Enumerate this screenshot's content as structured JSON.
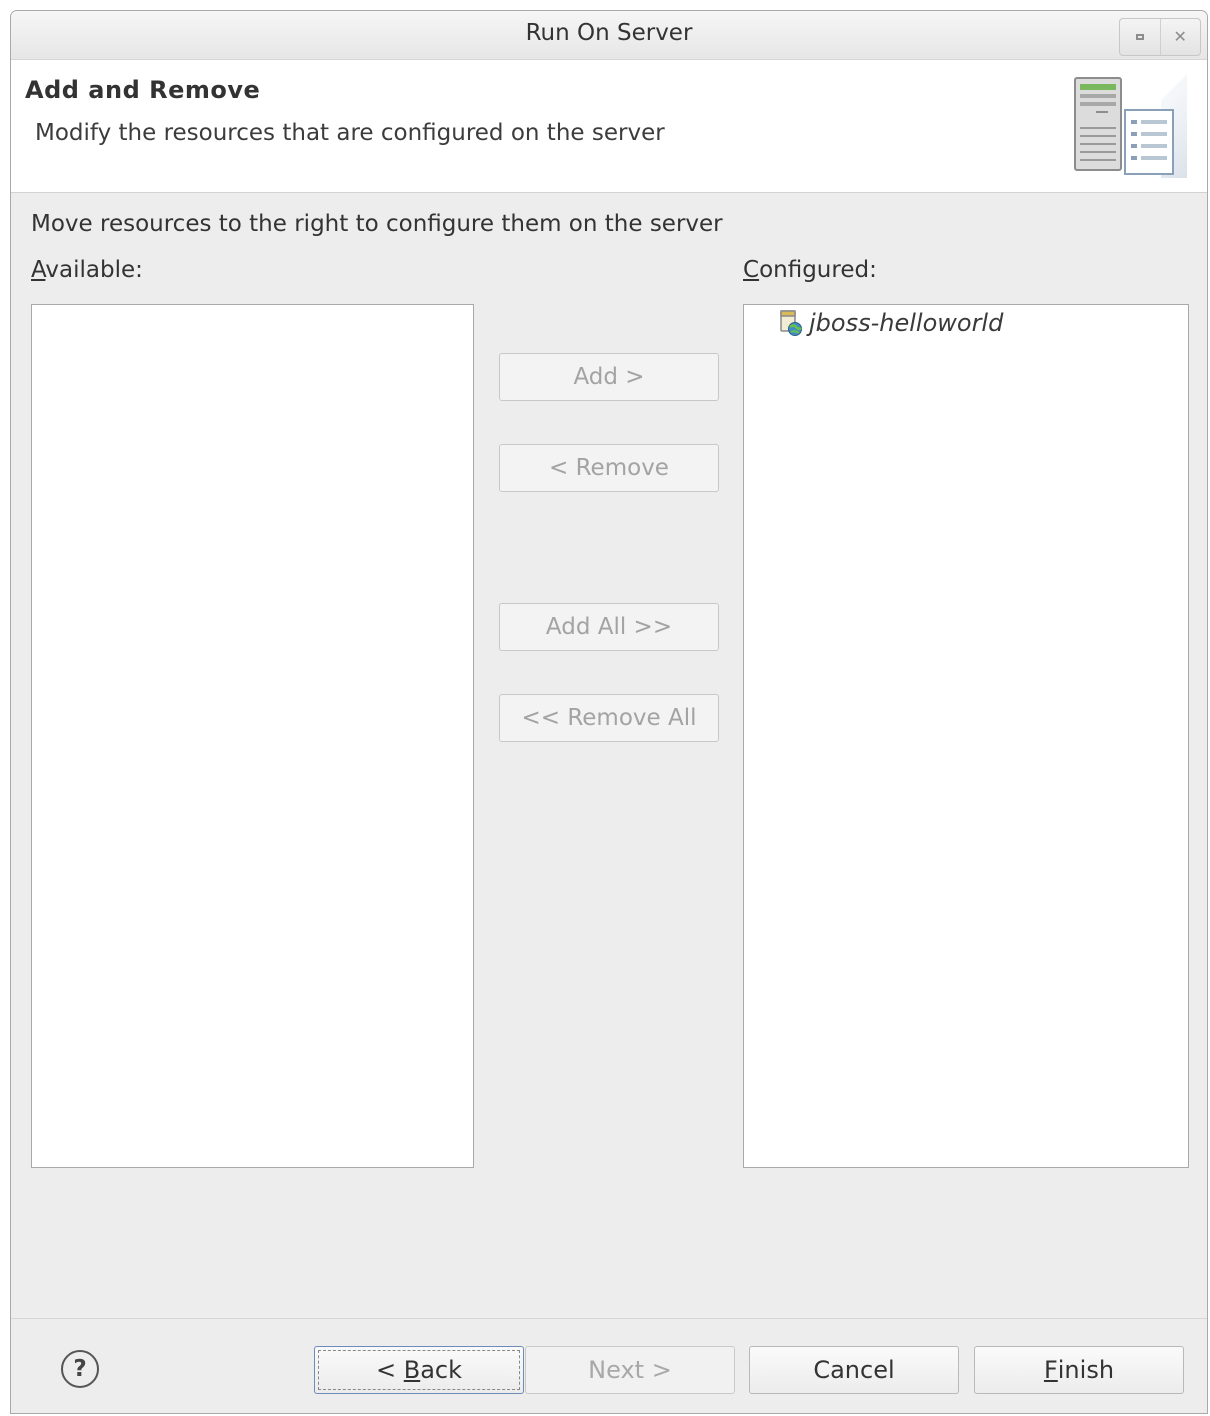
{
  "window": {
    "title": "Run On Server"
  },
  "banner": {
    "title": "Add and Remove",
    "subtitle": "Modify the resources that are configured on the server",
    "icon": "server-wizard-icon"
  },
  "content": {
    "instruction": "Move resources to the right to configure them on the server",
    "available": {
      "label_mnemonic": "A",
      "label_rest": "vailable:",
      "items": []
    },
    "configured": {
      "label_mnemonic": "C",
      "label_rest": "onfigured:",
      "items": [
        {
          "label": "jboss-helloworld",
          "icon": "web-project-icon"
        }
      ]
    },
    "buttons": {
      "add": "Add >",
      "remove": "< Remove",
      "add_all": "Add All >>",
      "remove_all": "<< Remove All"
    }
  },
  "footer": {
    "help_glyph": "?",
    "back_prefix": "< ",
    "back_mnemonic": "B",
    "back_rest": "ack",
    "next": "Next >",
    "cancel": "Cancel",
    "finish_mnemonic": "F",
    "finish_rest": "inish"
  },
  "colors": {
    "dialog_bg": "#ededed",
    "border": "#a9a9a9",
    "disabled_text": "#a3a3a3"
  }
}
